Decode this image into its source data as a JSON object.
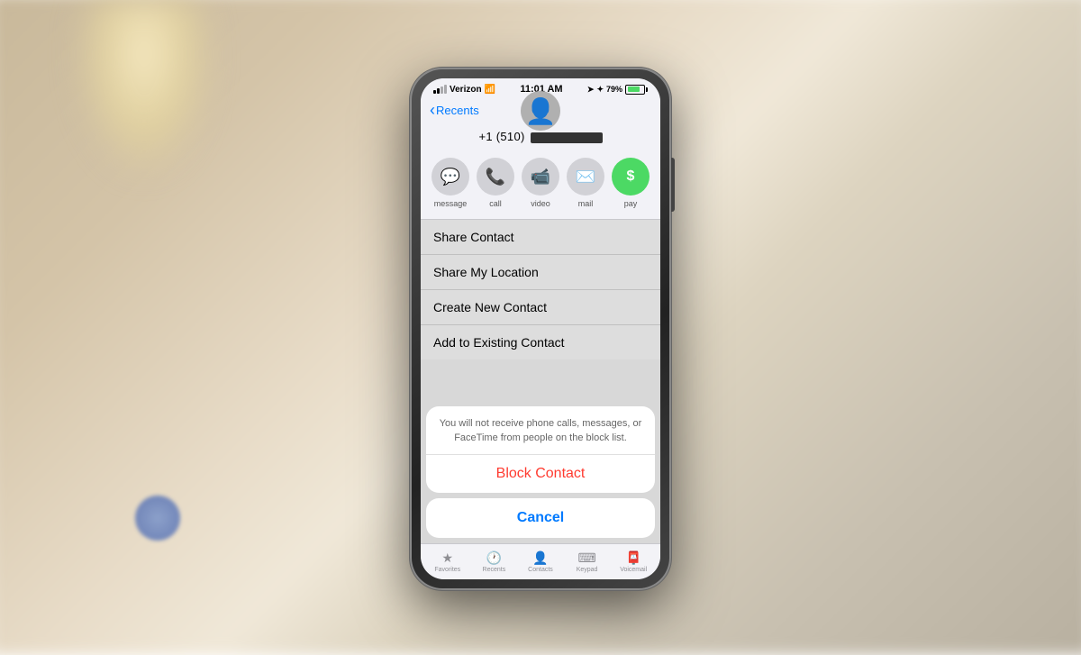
{
  "background": {
    "color": "#c8b89a"
  },
  "status_bar": {
    "carrier": "Verizon",
    "wifi_icon": "wifi",
    "time": "11:01 AM",
    "location_icon": "location",
    "bluetooth_icon": "bluetooth",
    "battery_percent": "79%",
    "battery_charging": true
  },
  "nav": {
    "back_label": "Recents"
  },
  "contact": {
    "phone_number_prefix": "+1 (510)",
    "phone_number_redacted": true
  },
  "action_buttons": [
    {
      "id": "message",
      "icon": "💬",
      "label": "message"
    },
    {
      "id": "call",
      "icon": "📞",
      "label": "call"
    },
    {
      "id": "video",
      "icon": "📹",
      "label": "video"
    },
    {
      "id": "mail",
      "icon": "✉️",
      "label": "mail"
    },
    {
      "id": "pay",
      "icon": "💲",
      "label": "pay"
    }
  ],
  "menu_items": [
    {
      "id": "share-contact",
      "label": "Share Contact"
    },
    {
      "id": "share-location",
      "label": "Share My Location"
    },
    {
      "id": "create-contact",
      "label": "Create New Contact"
    },
    {
      "id": "add-existing",
      "label": "Add to Existing Contact"
    }
  ],
  "action_sheet": {
    "message": "You will not receive phone calls, messages, or FaceTime from people on the block list.",
    "block_label": "Block Contact",
    "cancel_label": "Cancel"
  },
  "tab_bar": {
    "tabs": [
      {
        "id": "favorites",
        "icon": "★",
        "label": "Favorites"
      },
      {
        "id": "recents",
        "icon": "🕐",
        "label": "Recents"
      },
      {
        "id": "contacts",
        "icon": "👤",
        "label": "Contacts"
      },
      {
        "id": "keypad",
        "icon": "⌨",
        "label": "Keypad"
      },
      {
        "id": "voicemail",
        "icon": "📮",
        "label": "Voicemail"
      }
    ]
  }
}
